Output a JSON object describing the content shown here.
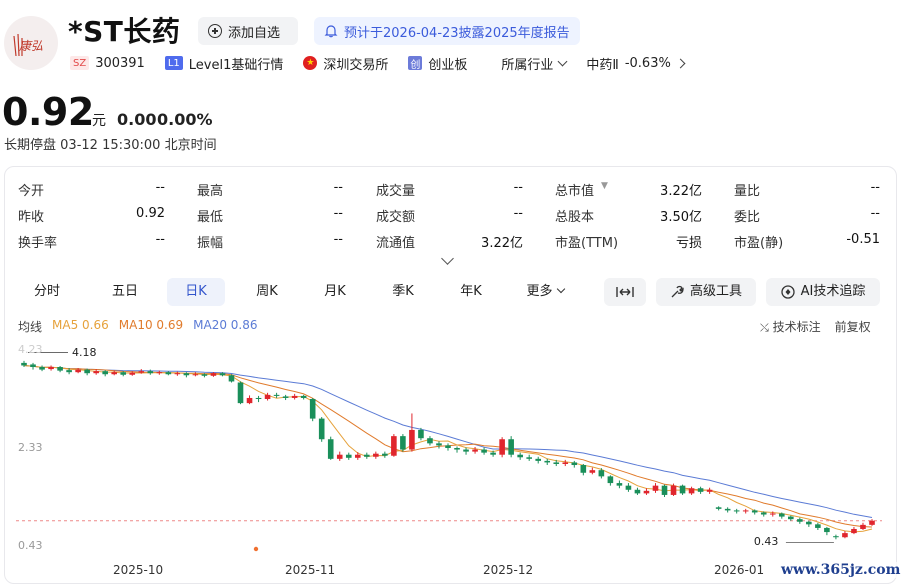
{
  "header": {
    "logo_text": "康弘",
    "title": "*ST长药",
    "watch_button": "添加自选",
    "notice": "预计于2026-04-23披露2025年度报告"
  },
  "meta": {
    "market_tag": "SZ",
    "code": "300391",
    "level_tag": "L1",
    "level_text": "Level1基础行情",
    "exchange": "深圳交易所",
    "board_tag": "创",
    "board": "创业板",
    "industry_label": "所属行业",
    "industry": "中药Ⅱ",
    "industry_change": "-0.63%"
  },
  "price": {
    "value": "0.92",
    "unit": "元",
    "change": "0.00",
    "change_pct": "0.00%",
    "status": "长期停盘",
    "time": "03-12 15:30:00 北京时间"
  },
  "quotes": [
    {
      "label": "今开",
      "value": "--"
    },
    {
      "label": "最高",
      "value": "--"
    },
    {
      "label": "成交量",
      "value": "--"
    },
    {
      "label": "总市值",
      "value": "3.22亿"
    },
    {
      "label": "量比",
      "value": "--"
    },
    {
      "label": "昨收",
      "value": "0.92"
    },
    {
      "label": "最低",
      "value": "--"
    },
    {
      "label": "成交额",
      "value": "--"
    },
    {
      "label": "总股本",
      "value": "3.50亿"
    },
    {
      "label": "委比",
      "value": "--"
    },
    {
      "label": "换手率",
      "value": "--"
    },
    {
      "label": "振幅",
      "value": "--"
    },
    {
      "label": "流通值",
      "value": "3.22亿"
    },
    {
      "label": "市盈(TTM)",
      "value": "亏损"
    },
    {
      "label": "市盈(静)",
      "value": "-0.51"
    }
  ],
  "tabs": [
    "分时",
    "五日",
    "日K",
    "周K",
    "月K",
    "季K",
    "年K",
    "更多"
  ],
  "active_tab": "日K",
  "tools": {
    "fit": "",
    "advanced": "高级工具",
    "ai": "AI技术追踪"
  },
  "ma": {
    "label": "均线",
    "ma5": "MA5 0.66",
    "ma10": "MA10 0.69",
    "ma20": "MA20 0.86"
  },
  "chart_links": {
    "annotate": "技术标注",
    "adjust": "前复权"
  },
  "colors": {
    "up": "#e0262d",
    "down": "#1a8f5a",
    "ma5": "#e6a23c",
    "ma10": "#e07b2c",
    "ma20": "#5b7bd5",
    "accent": "#3355cc"
  },
  "chart_data": {
    "type": "candlestick",
    "y_ticks": [
      "4.23",
      "2.33",
      "0.43"
    ],
    "ylim": [
      0.43,
      4.23
    ],
    "x_ticks": [
      "2025-10",
      "2025-11",
      "2025-12",
      "2026-01"
    ],
    "high_label": "4.18",
    "low_label": "0.43",
    "last_close": 0.92,
    "candles": [
      [
        3.98,
        3.93,
        4.02,
        3.9
      ],
      [
        3.95,
        3.9,
        3.98,
        3.85
      ],
      [
        3.9,
        3.85,
        3.93,
        3.82
      ],
      [
        3.86,
        3.9,
        3.93,
        3.83
      ],
      [
        3.9,
        3.83,
        3.92,
        3.8
      ],
      [
        3.84,
        3.8,
        3.88,
        3.76
      ],
      [
        3.8,
        3.85,
        3.88,
        3.78
      ],
      [
        3.85,
        3.78,
        3.87,
        3.74
      ],
      [
        3.78,
        3.82,
        3.86,
        3.75
      ],
      [
        3.82,
        3.76,
        3.84,
        3.72
      ],
      [
        3.76,
        3.8,
        3.83,
        3.74
      ],
      [
        3.8,
        3.75,
        3.82,
        3.72
      ],
      [
        3.75,
        3.79,
        3.82,
        3.73
      ],
      [
        3.79,
        3.82,
        3.86,
        3.77
      ],
      [
        3.82,
        3.78,
        3.85,
        3.75
      ],
      [
        3.78,
        3.8,
        3.83,
        3.75
      ],
      [
        3.8,
        3.76,
        3.82,
        3.74
      ],
      [
        3.76,
        3.78,
        3.81,
        3.73
      ],
      [
        3.78,
        3.74,
        3.8,
        3.7
      ],
      [
        3.74,
        3.76,
        3.8,
        3.72
      ],
      [
        3.76,
        3.73,
        3.78,
        3.7
      ],
      [
        3.73,
        3.78,
        3.8,
        3.71
      ],
      [
        3.78,
        3.74,
        3.8,
        3.72
      ],
      [
        3.74,
        3.62,
        3.76,
        3.6
      ],
      [
        3.6,
        3.2,
        3.62,
        3.18
      ],
      [
        3.2,
        3.3,
        3.35,
        3.18
      ],
      [
        3.3,
        3.28,
        3.34,
        3.22
      ],
      [
        3.28,
        3.36,
        3.4,
        3.25
      ],
      [
        3.36,
        3.34,
        3.4,
        3.3
      ],
      [
        3.33,
        3.3,
        3.36,
        3.26
      ],
      [
        3.3,
        3.34,
        3.38,
        3.27
      ],
      [
        3.34,
        3.3,
        3.36,
        3.27
      ],
      [
        3.28,
        2.9,
        3.3,
        2.85
      ],
      [
        2.9,
        2.5,
        2.93,
        2.45
      ],
      [
        2.5,
        2.12,
        2.55,
        2.1
      ],
      [
        2.12,
        2.2,
        2.26,
        2.08
      ],
      [
        2.2,
        2.14,
        2.24,
        2.1
      ],
      [
        2.14,
        2.2,
        2.25,
        2.1
      ],
      [
        2.2,
        2.16,
        2.24,
        2.12
      ],
      [
        2.16,
        2.22,
        2.26,
        2.12
      ],
      [
        2.22,
        2.18,
        2.26,
        2.14
      ],
      [
        2.18,
        2.56,
        2.6,
        2.16
      ],
      [
        2.56,
        2.3,
        2.6,
        2.26
      ],
      [
        2.3,
        2.68,
        3.0,
        2.26
      ],
      [
        2.68,
        2.52,
        2.72,
        2.48
      ],
      [
        2.52,
        2.42,
        2.56,
        2.38
      ],
      [
        2.42,
        2.38,
        2.46,
        2.32
      ],
      [
        2.38,
        2.33,
        2.42,
        2.28
      ],
      [
        2.33,
        2.3,
        2.36,
        2.24
      ],
      [
        2.3,
        2.26,
        2.34,
        2.2
      ],
      [
        2.26,
        2.3,
        2.35,
        2.22
      ],
      [
        2.3,
        2.24,
        2.34,
        2.2
      ],
      [
        2.24,
        2.2,
        2.28,
        2.16
      ],
      [
        2.2,
        2.5,
        2.54,
        2.15
      ],
      [
        2.5,
        2.2,
        2.56,
        2.15
      ],
      [
        2.2,
        2.15,
        2.24,
        2.1
      ],
      [
        2.15,
        2.12,
        2.2,
        2.08
      ],
      [
        2.12,
        2.08,
        2.16,
        2.03
      ],
      [
        2.08,
        2.05,
        2.12,
        2.0
      ],
      [
        2.05,
        2.02,
        2.1,
        1.98
      ],
      [
        2.02,
        2.05,
        2.1,
        1.98
      ],
      [
        2.05,
        2.0,
        2.08,
        1.95
      ],
      [
        2.0,
        1.85,
        2.02,
        1.8
      ],
      [
        1.85,
        1.9,
        1.95,
        1.82
      ],
      [
        1.9,
        1.78,
        1.94,
        1.74
      ],
      [
        1.78,
        1.65,
        1.8,
        1.6
      ],
      [
        1.65,
        1.6,
        1.7,
        1.55
      ],
      [
        1.6,
        1.52,
        1.65,
        1.48
      ],
      [
        1.52,
        1.45,
        1.56,
        1.42
      ],
      [
        1.45,
        1.5,
        1.55,
        1.42
      ],
      [
        1.5,
        1.6,
        1.65,
        1.46
      ],
      [
        1.6,
        1.42,
        1.62,
        1.38
      ],
      [
        1.42,
        1.6,
        1.64,
        1.4
      ],
      [
        1.6,
        1.45,
        1.62,
        1.42
      ],
      [
        1.45,
        1.55,
        1.58,
        1.42
      ],
      [
        1.55,
        1.48,
        1.58,
        1.44
      ],
      [
        1.48,
        1.52,
        1.56,
        1.44
      ],
      [
        1.18,
        1.15,
        1.2,
        1.12
      ],
      [
        1.15,
        1.12,
        1.18,
        1.08
      ],
      [
        1.12,
        1.1,
        1.15,
        1.06
      ],
      [
        1.1,
        1.12,
        1.15,
        1.06
      ],
      [
        1.12,
        1.08,
        1.14,
        1.04
      ],
      [
        1.08,
        1.04,
        1.1,
        1.0
      ],
      [
        1.04,
        1.06,
        1.1,
        1.0
      ],
      [
        1.06,
        1.0,
        1.08,
        0.96
      ],
      [
        1.0,
        0.95,
        1.02,
        0.92
      ],
      [
        0.95,
        0.9,
        0.98,
        0.86
      ],
      [
        0.9,
        0.85,
        0.92,
        0.8
      ],
      [
        0.85,
        0.78,
        0.88,
        0.74
      ],
      [
        0.78,
        0.7,
        0.8,
        0.64
      ],
      [
        0.62,
        0.6,
        0.65,
        0.56
      ],
      [
        0.6,
        0.68,
        0.72,
        0.58
      ],
      [
        0.68,
        0.76,
        0.8,
        0.66
      ],
      [
        0.76,
        0.84,
        0.88,
        0.74
      ],
      [
        0.84,
        0.92,
        0.95,
        0.82
      ]
    ]
  }
}
